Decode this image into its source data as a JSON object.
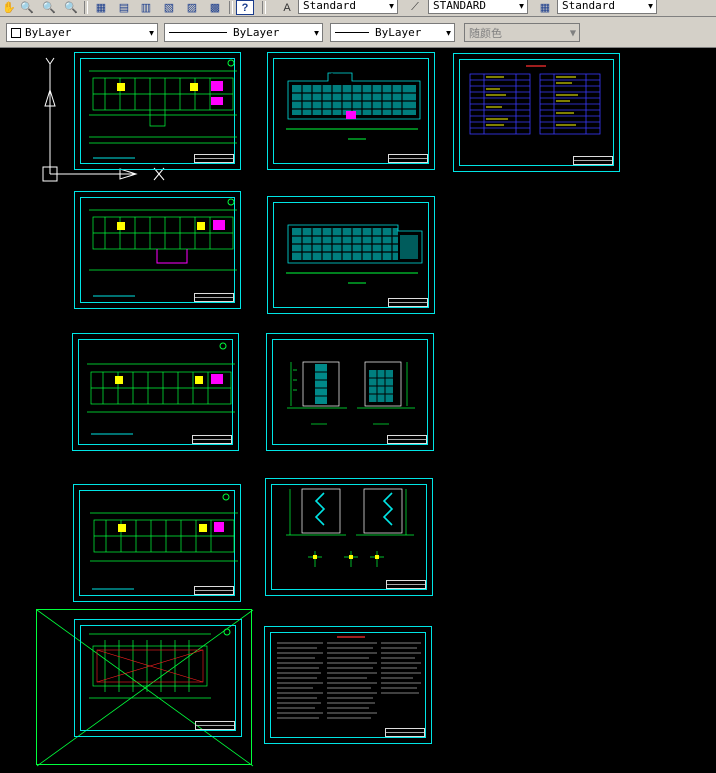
{
  "toolbar": {
    "text_style": "Standard",
    "dim_style": "STANDARD",
    "table_style": "Standard"
  },
  "properties": {
    "color": "ByLayer",
    "linetype": "ByLayer",
    "lineweight": "ByLayer",
    "plot_style": "随颜色"
  },
  "colors": {
    "toolbar_bg": "#d4d0c8",
    "canvas_bg": "#000000",
    "frame": "#00e5e5",
    "drawing": "#00ff3c",
    "highlight_yellow": "#ffff00",
    "highlight_magenta": "#ff00ff"
  },
  "icons": [
    "pan-icon",
    "zoom-realtime-icon",
    "zoom-window-icon",
    "zoom-previous-icon",
    "properties-icon",
    "design-center-icon",
    "tool-palettes-icon",
    "sheet-set-icon",
    "markup-icon",
    "calculator-icon",
    "help-icon",
    "text-style-icon",
    "dim-style-icon",
    "table-style-icon"
  ]
}
